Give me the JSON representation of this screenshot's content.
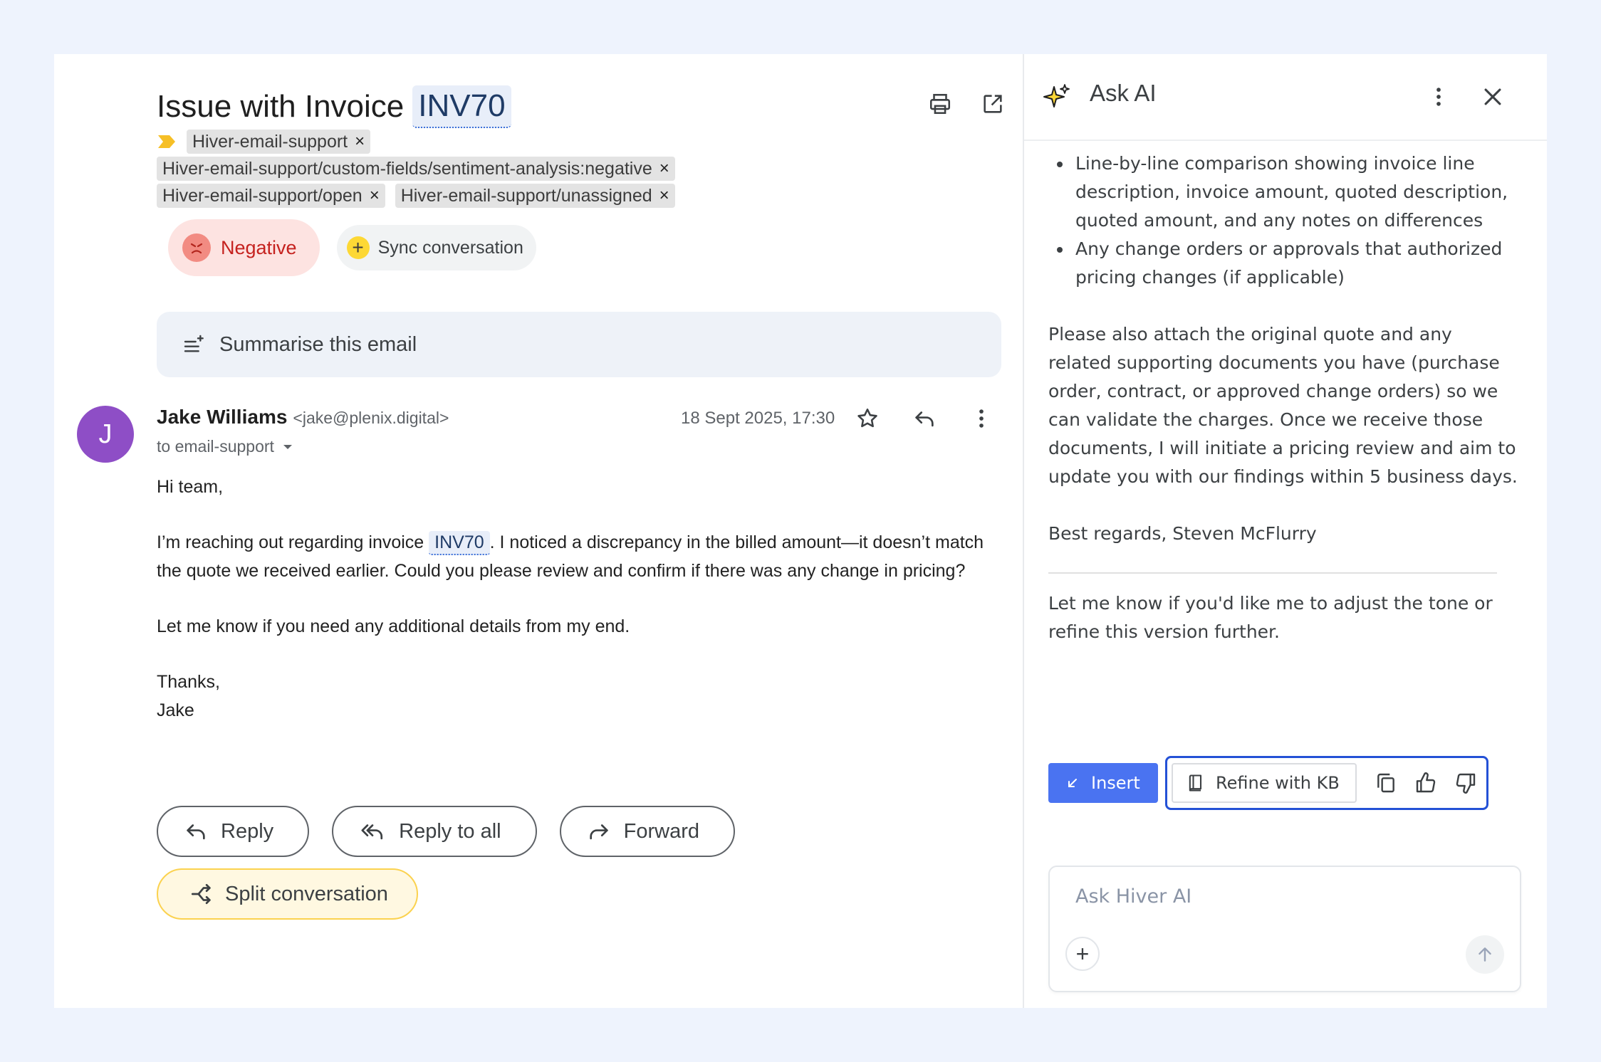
{
  "email": {
    "subject_prefix": "Issue with Invoice",
    "subject_invoice": "INV70",
    "labels": [
      {
        "text": "Hiver-email-support"
      },
      {
        "text": "Hiver-email-support/custom-fields/sentiment-analysis:negative"
      },
      {
        "text": "Hiver-email-support/open"
      },
      {
        "text": "Hiver-email-support/unassigned"
      }
    ],
    "label_remove_glyph": "×",
    "sentiment": "Negative",
    "sync_label": "Sync conversation",
    "summarise_label": "Summarise this email",
    "sender": {
      "initial": "J",
      "name": "Jake Williams",
      "email": "<jake@plenix.digital>",
      "to": "to email-support",
      "date": "18 Sept 2025, 17:30"
    },
    "body": {
      "greeting": "Hi team,",
      "p1_before": "I’m reaching out regarding invoice ",
      "p1_invoice": "INV70",
      "p1_after": ". I noticed a discrepancy in the billed amount—it doesn’t match the quote we received earlier. Could you please review and confirm if there was any change in pricing?",
      "p2": "Let me know if you need any additional details from my end.",
      "signoff": "Thanks,",
      "signature": "Jake"
    },
    "actions": {
      "reply": "Reply",
      "reply_all": "Reply to all",
      "forward": "Forward",
      "split": "Split conversation"
    }
  },
  "ai": {
    "title": "Ask AI",
    "bullets": [
      "Line-by-line comparison showing invoice line description, invoice amount, quoted description, quoted amount, and any notes on differences",
      "Any change orders or approvals that authorized pricing changes (if applicable)"
    ],
    "paragraph": "Please also attach the original quote and any related supporting documents you have (purchase order, contract, or approved change orders) so we can validate the charges. Once we receive those documents, I will initiate a pricing review and aim to update you with our findings within 5 business days.",
    "closing": "Best regards, Steven McFlurry",
    "followup": "Let me know if you'd like me to adjust the tone or refine this version further.",
    "insert_label": "Insert",
    "refine_label": "Refine with KB",
    "ask_placeholder": "Ask Hiver AI"
  },
  "colors": {
    "background": "#eef3fd",
    "accent_blue": "#4a73f1",
    "negative_red": "#c5221f",
    "avatar_purple": "#8e4ec6",
    "split_yellow": "#fbd24f"
  },
  "icons": [
    "print-icon",
    "open-in-new-icon",
    "label-arrow-icon",
    "angry-face-icon",
    "plus-icon",
    "summarise-icon",
    "star-icon",
    "reply-icon",
    "more-vert-icon",
    "reply-all-icon",
    "forward-icon",
    "split-icon",
    "sparkle-icon",
    "close-icon",
    "insert-icon",
    "book-icon",
    "copy-icon",
    "thumbs-up-icon",
    "thumbs-down-icon",
    "send-arrow-icon"
  ]
}
